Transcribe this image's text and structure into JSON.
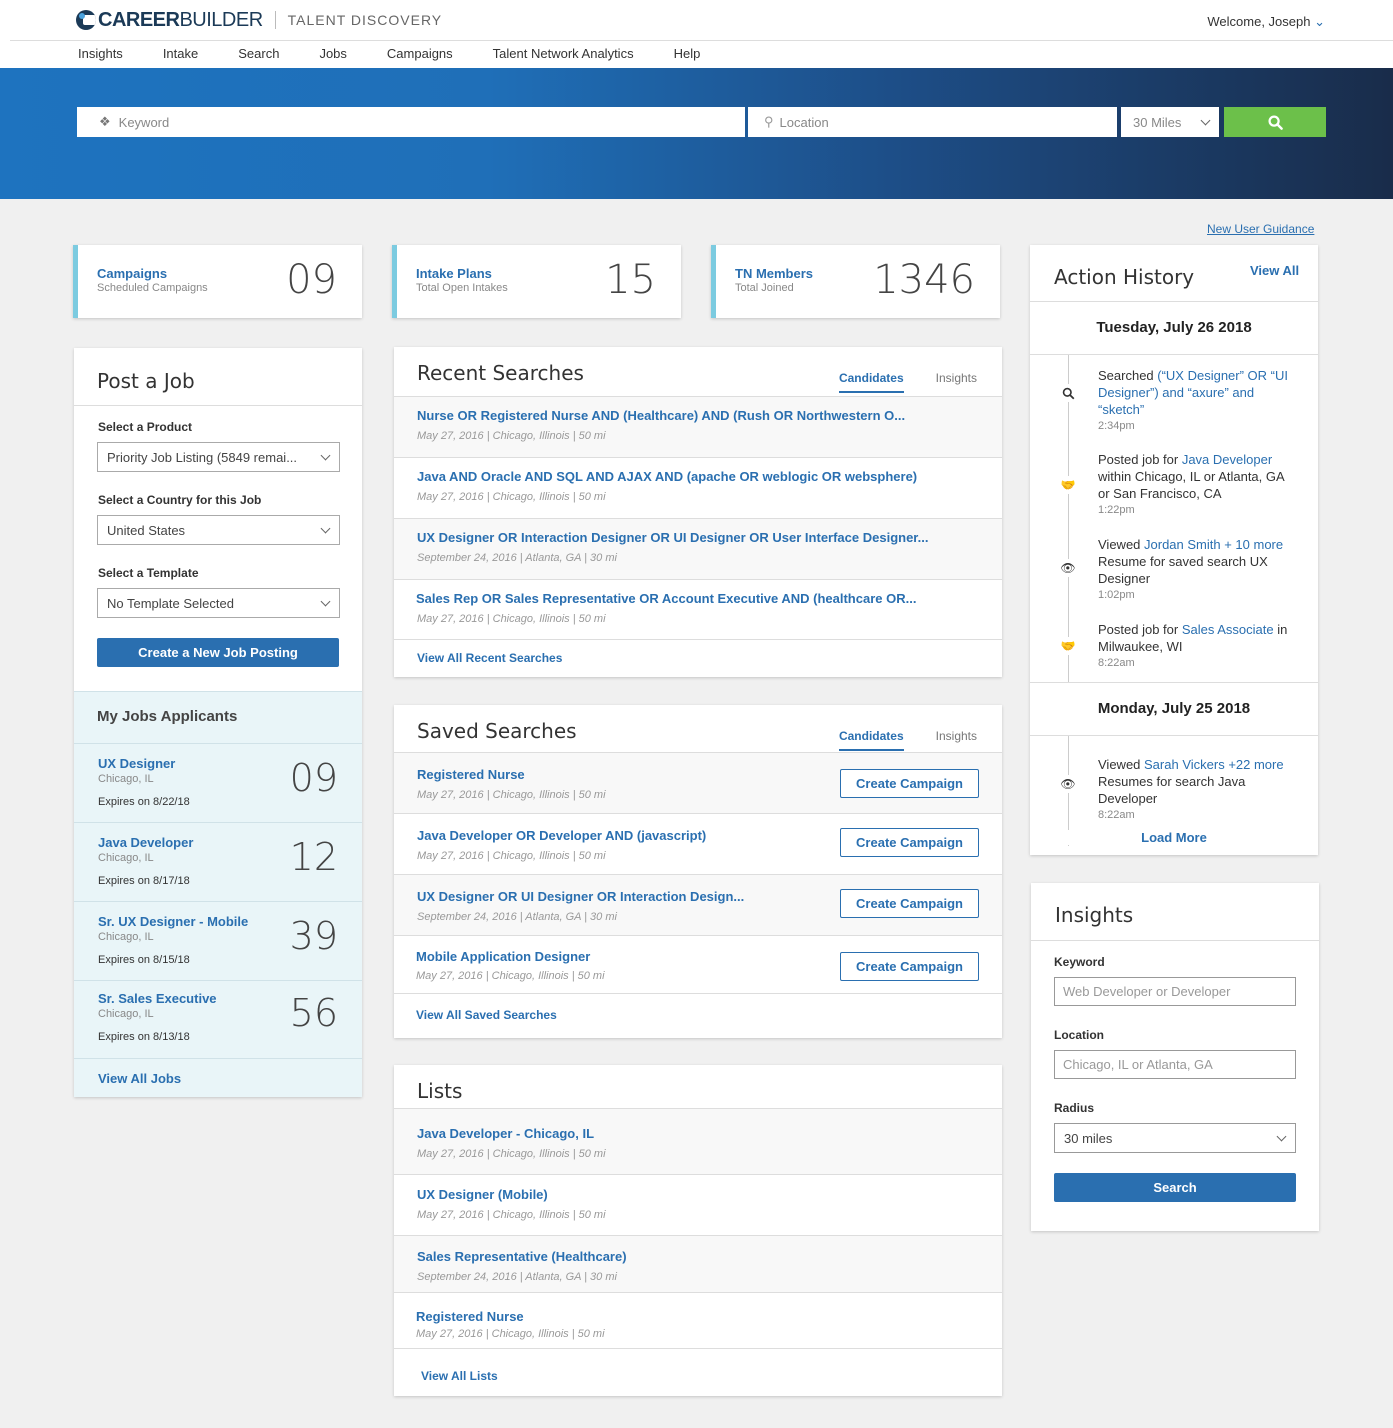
{
  "header": {
    "brand_bold": "CAREER",
    "brand_light": "BUILDER",
    "product": "TALENT DISCOVERY",
    "welcome": "Welcome, Joseph"
  },
  "nav": [
    "Insights",
    "Intake",
    "Search",
    "Jobs",
    "Campaigns",
    "Talent Network Analytics",
    "Help"
  ],
  "search": {
    "keyword_placeholder": "Keyword",
    "location_placeholder": "Location",
    "radius": "30 Miles"
  },
  "guidance_link": "New User Guidance",
  "stats": [
    {
      "title": "Campaigns",
      "sub": "Scheduled Campaigns",
      "value": "09"
    },
    {
      "title": "Intake Plans",
      "sub": "Total Open Intakes",
      "value": "15"
    },
    {
      "title": "TN Members",
      "sub": "Total Joined",
      "value": "1346"
    }
  ],
  "post_job": {
    "title": "Post a Job",
    "product_label": "Select a Product",
    "product_value": "Priority Job Listing (5849 remai...",
    "country_label": "Select a Country for this Job",
    "country_value": "United States",
    "template_label": "Select a Template",
    "template_value": "No Template Selected",
    "button": "Create a New Job Posting"
  },
  "my_jobs": {
    "title": "My Jobs Applicants",
    "items": [
      {
        "title": "UX Designer",
        "loc": "Chicago, IL",
        "expires": "Expires on 8/22/18",
        "count": "09"
      },
      {
        "title": "Java Developer",
        "loc": "Chicago, IL",
        "expires": "Expires on 8/17/18",
        "count": "12"
      },
      {
        "title": "Sr. UX Designer - Mobile",
        "loc": "Chicago, IL",
        "expires": "Expires on 8/15/18",
        "count": "39"
      },
      {
        "title": "Sr. Sales Executive",
        "loc": "Chicago, IL",
        "expires": "Expires on 8/13/18",
        "count": "56"
      }
    ],
    "view_all": "View All Jobs"
  },
  "recent": {
    "title": "Recent Searches",
    "tab1": "Candidates",
    "tab2": "Insights",
    "items": [
      {
        "q": "Nurse OR Registered Nurse AND (Healthcare) AND (Rush OR Northwestern O...",
        "meta": "May 27, 2016  |  Chicago, Illinois  |  50 mi"
      },
      {
        "q": "Java AND Oracle AND SQL AND AJAX AND (apache OR weblogic OR websphere)",
        "meta": "May 27, 2016  |  Chicago, Illinois  |  50 mi"
      },
      {
        "q": "UX Designer OR Interaction Designer OR UI Designer OR User Interface Designer...",
        "meta": "September 24, 2016  |  Atlanta, GA  |  30 mi"
      },
      {
        "q": "Sales Rep OR Sales Representative OR Account Executive AND (healthcare OR...",
        "meta": "May 27, 2016  |  Chicago, Illinois  |  50 mi"
      }
    ],
    "view_all": "View All Recent Searches"
  },
  "saved": {
    "title": "Saved Searches",
    "tab1": "Candidates",
    "tab2": "Insights",
    "btn": "Create Campaign",
    "items": [
      {
        "q": "Registered Nurse",
        "meta": "May 27, 2016  |  Chicago, Illinois  |  50 mi"
      },
      {
        "q": "Java Developer OR Developer AND (javascript)",
        "meta": "May 27, 2016  |  Chicago, Illinois  |  50 mi"
      },
      {
        "q": "UX Designer OR UI Designer OR Interaction Design...",
        "meta": "September 24, 2016  |  Atlanta, GA  |  30 mi"
      },
      {
        "q": "Mobile Application Designer",
        "meta": "May 27, 2016  |  Chicago, Illinois  |  50 mi"
      }
    ],
    "view_all": "View All Saved Searches"
  },
  "lists": {
    "title": "Lists",
    "items": [
      {
        "q": "Java Developer - Chicago, IL",
        "meta": "May 27, 2016  |  Chicago, Illinois  |  50 mi"
      },
      {
        "q": "UX Designer (Mobile)",
        "meta": "May 27, 2016  |  Chicago, Illinois  |  50 mi"
      },
      {
        "q": "Sales Representative (Healthcare)",
        "meta": "September 24, 2016  |  Atlanta, GA  |  30 mi"
      },
      {
        "q": "Registered Nurse",
        "meta": "May 27, 2016  |  Chicago, Illinois  |  50 mi"
      }
    ],
    "view_all": "View All Lists"
  },
  "history": {
    "title": "Action History",
    "view_all": "View All",
    "day1": "Tuesday, July 26 2018",
    "day2": "Monday, July 25 2018",
    "e1": {
      "pre": "Searched ",
      "link": "(“UX Designer” OR “UI Designer”) and “axure” and “sketch”",
      "post": "",
      "time": "2:34pm"
    },
    "e2": {
      "pre": "Posted job for ",
      "link": "Java Developer",
      "post": " within Chicago, IL or Atlanta, GA or San Francisco, CA",
      "time": "1:22pm"
    },
    "e3": {
      "pre": "Viewed ",
      "link": "Jordan Smith + 10 more",
      "post": " Resume for saved search UX Designer",
      "time": "1:02pm"
    },
    "e4": {
      "pre": "Posted job for ",
      "link": "Sales Associate",
      "post": " in Milwaukee, WI",
      "time": "8:22am"
    },
    "e5": {
      "pre": "Viewed ",
      "link": "Sarah Vickers +22 more",
      "post": " Resumes for search Java Developer",
      "time": "8:22am"
    },
    "load_more": "Load More"
  },
  "insights": {
    "title": "Insights",
    "kw_label": "Keyword",
    "kw_placeholder": "Web Developer or Developer",
    "loc_label": "Location",
    "loc_placeholder": "Chicago, IL or Atlanta, GA",
    "radius_label": "Radius",
    "radius_value": "30 miles",
    "button": "Search"
  }
}
